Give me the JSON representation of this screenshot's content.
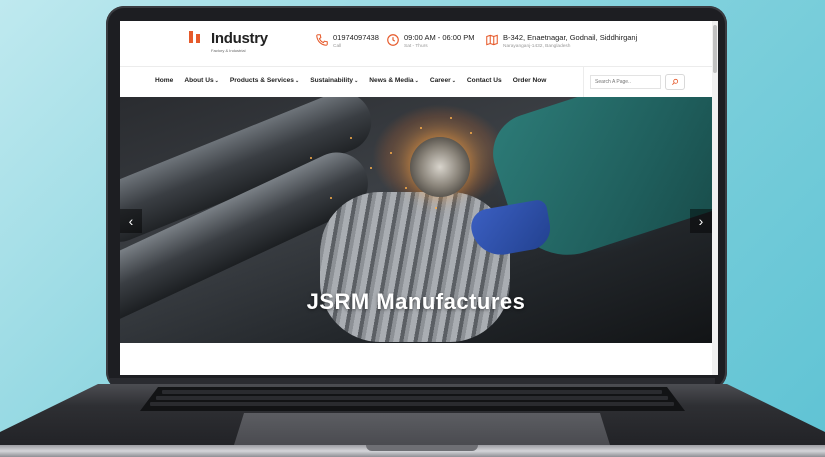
{
  "brand": {
    "name": "Industry",
    "tagline": "Factory & Industrial"
  },
  "contact": [
    {
      "icon": "phone-icon",
      "main": "01974097438",
      "sub": "Call"
    },
    {
      "icon": "clock-icon",
      "main": "09:00 AM - 06:00 PM",
      "sub": "Sat - Thurs"
    },
    {
      "icon": "map-icon",
      "main": "B-342, Enaetnagar, Godnail, Siddhirganj",
      "sub": "Narayanganj-1432, Bangladesh"
    }
  ],
  "nav": [
    {
      "label": "Home",
      "dropdown": false
    },
    {
      "label": "About Us",
      "dropdown": true
    },
    {
      "label": "Products & Services",
      "dropdown": true
    },
    {
      "label": "Sustainability",
      "dropdown": true
    },
    {
      "label": "News & Media",
      "dropdown": true
    },
    {
      "label": "Career",
      "dropdown": true
    },
    {
      "label": "Contact Us",
      "dropdown": false
    },
    {
      "label": "Order Now",
      "dropdown": false
    }
  ],
  "search": {
    "placeholder": "Search A Page..",
    "icon": "search-icon"
  },
  "hero": {
    "title": "JSRM Manufactures",
    "prev_icon": "chevron-left-icon",
    "next_icon": "chevron-right-icon"
  },
  "colors": {
    "accent": "#e65a2b",
    "background": "#7fd0dc"
  }
}
